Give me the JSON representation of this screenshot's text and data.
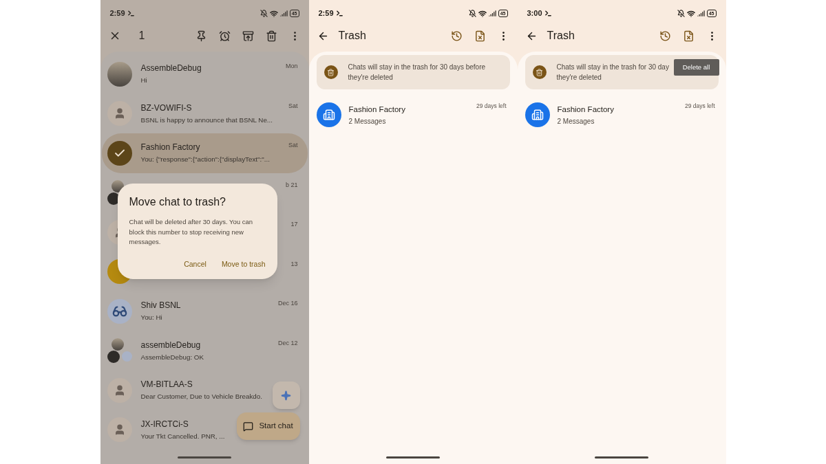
{
  "screens": [
    {
      "kind": "conversation_list",
      "status_bar": {
        "time": "2:59",
        "battery": "45"
      },
      "selection_bar": {
        "count": "1"
      },
      "conversations": [
        {
          "name": "AssembleDebug",
          "snippet": "Hi",
          "date": "Mon",
          "kind": "photo",
          "selected": false
        },
        {
          "name": "BZ-VOWIFI-S",
          "snippet": "BSNL is happy to announce that BSNL Ne...",
          "date": "Sat",
          "kind": "person",
          "selected": false
        },
        {
          "name": "Fashion Factory",
          "snippet": "You: {\"response\":{\"action\":{\"displayText\":\"...",
          "date": "Sat",
          "selected": true
        },
        {
          "date": "b 21",
          "kind": "group",
          "selected": false
        },
        {
          "date": "17",
          "kind": "person",
          "selected": false
        },
        {
          "date": "13",
          "kind": "yellow",
          "selected": false
        },
        {
          "name": "Shiv BSNL",
          "snippet": "You: Hi",
          "date": "Dec 16",
          "kind": "glasses",
          "selected": false
        },
        {
          "name": "assembleDebug",
          "snippet": "AssembleDebug: OK",
          "date": "Dec 12",
          "kind": "group",
          "selected": false
        },
        {
          "name": "VM-BITLAA-S",
          "snippet": "Dear Customer, Due to Vehicle Breakdo.",
          "kind": "person",
          "selected": false
        },
        {
          "name": "JX-IRCTCi-S",
          "snippet": "Your Tkt Cancelled. PNR, ...",
          "kind": "person",
          "selected": false
        }
      ],
      "dialog": {
        "title": "Move chat to trash?",
        "body": "Chat will be deleted after 30 days. You can block this number to stop receiving new messages.",
        "buttons": [
          "Cancel",
          "Move to trash"
        ]
      },
      "fab": {
        "label": "Start chat"
      }
    },
    {
      "kind": "trash",
      "status_bar": {
        "time": "2:59",
        "battery": "45"
      },
      "title": "Trash",
      "banner": [
        "Chats will stay in the trash for 30 days before",
        "they're deleted"
      ],
      "items": [
        {
          "name": "Fashion Factory",
          "detail": "2 Messages",
          "time_left": "29 days left"
        }
      ]
    },
    {
      "kind": "trash",
      "status_bar": {
        "time": "3:00",
        "battery": "45"
      },
      "title": "Trash",
      "banner": [
        "Chats will stay in the trash for 30 day",
        "they're deleted"
      ],
      "items": [
        {
          "name": "Fashion Factory",
          "detail": "2 Messages",
          "time_left": "29 days left"
        }
      ],
      "tooltip": "Delete all"
    }
  ]
}
